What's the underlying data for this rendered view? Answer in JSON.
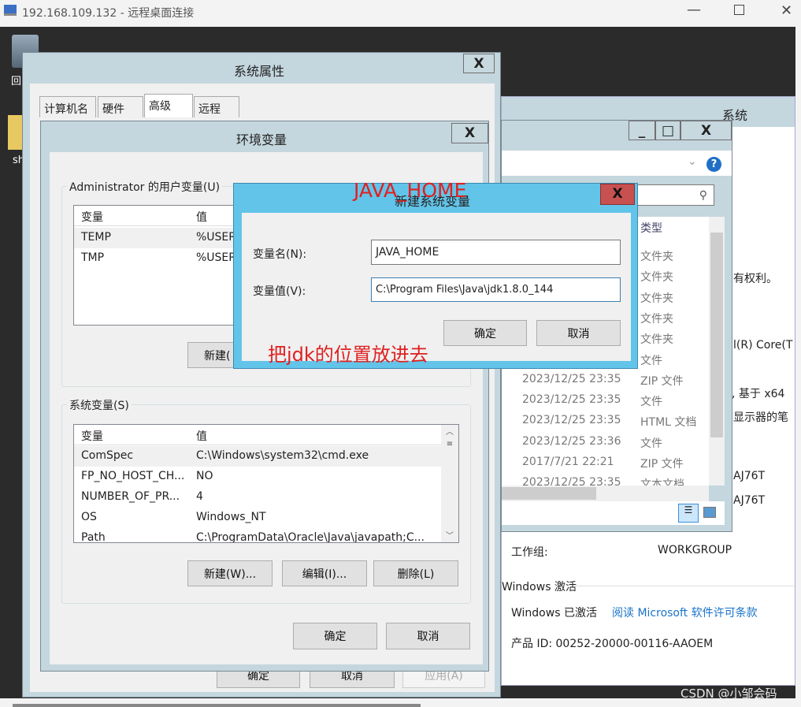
{
  "rdp": {
    "title": "192.168.109.132 - 远程桌面连接"
  },
  "desktop": {
    "icons": [
      {
        "label": "回"
      },
      {
        "label": "sh"
      }
    ]
  },
  "system_window": {
    "title": "系统",
    "texts": [
      "有权利。",
      "l(R) Core(T",
      ", 基于 x64",
      "显示器的笔",
      "AJ76T",
      "AJ76T"
    ],
    "workgroup_label": "工作组:",
    "workgroup_value": "WORKGROUP",
    "activation_header": "Windows 激活",
    "activated": "Windows 已激活",
    "license_link": "阅读 Microsoft 软件许可条款",
    "product_id": "产品 ID: 00252-20000-00116-AAOEM",
    "link_color": "#1a73c8"
  },
  "explorer": {
    "column_type": "类型",
    "rows": [
      {
        "date": "",
        "type": "文件夹"
      },
      {
        "date": "",
        "type": "文件夹"
      },
      {
        "date": "",
        "type": "文件夹"
      },
      {
        "date": "",
        "type": "文件夹"
      },
      {
        "date": "",
        "type": "文件夹"
      },
      {
        "date": "",
        "type": "文件"
      },
      {
        "date": "2023/12/25 23:35",
        "type": "ZIP 文件"
      },
      {
        "date": "2023/12/25 23:35",
        "type": "文件"
      },
      {
        "date": "2023/12/25 23:35",
        "type": "HTML 文档"
      },
      {
        "date": "2023/12/25 23:36",
        "type": "文件"
      },
      {
        "date": "2017/7/21 22:21",
        "type": "ZIP 文件"
      },
      {
        "date": "2023/12/25 23:35",
        "type": "文本文档"
      }
    ]
  },
  "sysprops": {
    "title": "系统属性",
    "tabs": [
      "计算机名",
      "硬件",
      "高级",
      "远程"
    ],
    "active_tab": "高级",
    "ok": "确定",
    "cancel": "取消",
    "apply": "应用(A)"
  },
  "envvars": {
    "title": "环境变量",
    "user_group": "Administrator 的用户变量(U)",
    "col_var": "变量",
    "col_val": "值",
    "user_rows": [
      {
        "name": "TEMP",
        "value": "%USER"
      },
      {
        "name": "TMP",
        "value": "%USER"
      }
    ],
    "user_new": "新建(",
    "sys_group": "系统变量(S)",
    "sys_rows": [
      {
        "name": "ComSpec",
        "value": "C:\\Windows\\system32\\cmd.exe"
      },
      {
        "name": "FP_NO_HOST_CH...",
        "value": "NO"
      },
      {
        "name": "NUMBER_OF_PR...",
        "value": "4"
      },
      {
        "name": "OS",
        "value": "Windows_NT"
      },
      {
        "name": "Path",
        "value": "C:\\ProgramData\\Oracle\\Java\\javapath;C..."
      }
    ],
    "sys_new": "新建(W)...",
    "sys_edit": "编辑(I)...",
    "sys_delete": "删除(L)",
    "ok": "确定",
    "cancel": "取消"
  },
  "newvar": {
    "title": "新建系统变量",
    "name_label": "变量名(N):",
    "name_value": "JAVA_HOME",
    "value_label": "变量值(V):",
    "value_value": "C:\\Program Files\\Java\\jdk1.8.0_144",
    "ok": "确定",
    "cancel": "取消",
    "accent": "#62c4e8",
    "close_color": "#c75050"
  },
  "annotations": {
    "top": "JAVA_HOME",
    "bottom": "把jdk的位置放进去",
    "color": "#e02020"
  },
  "watermark": "CSDN @小邹会码"
}
